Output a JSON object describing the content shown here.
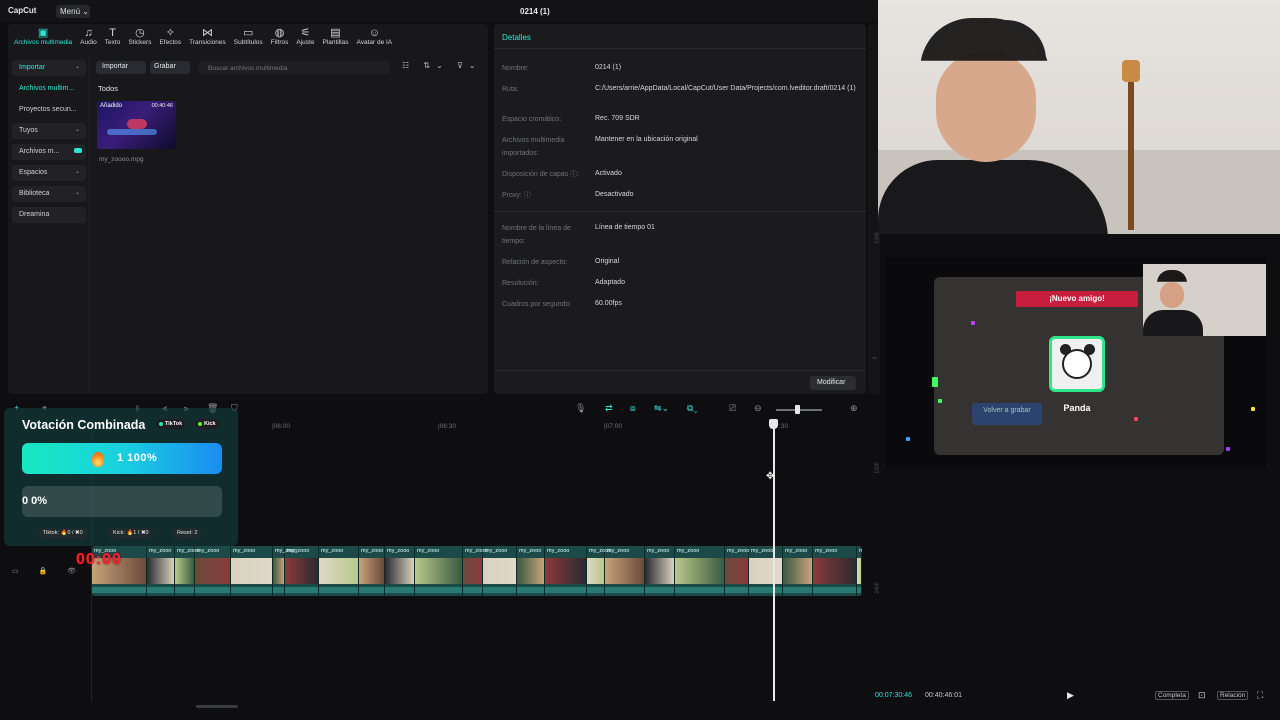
{
  "app": {
    "logo": "CapCut",
    "menu_label": "Menú ⌄",
    "project_title": "0214 (1)"
  },
  "toolbar": [
    {
      "label": "Archivos multimedia",
      "icon": "media-icon",
      "glyph": "▣",
      "active": true
    },
    {
      "label": "Audio",
      "icon": "audio-icon",
      "glyph": "♫"
    },
    {
      "label": "Texto",
      "icon": "text-icon",
      "glyph": "T"
    },
    {
      "label": "Stickers",
      "icon": "sticker-icon",
      "glyph": "◷"
    },
    {
      "label": "Efectos",
      "icon": "effects-icon",
      "glyph": "✧"
    },
    {
      "label": "Transiciones",
      "icon": "transitions-icon",
      "glyph": "⋈"
    },
    {
      "label": "Subtítulos",
      "icon": "subtitles-icon",
      "glyph": "▭"
    },
    {
      "label": "Filtros",
      "icon": "filters-icon",
      "glyph": "◍"
    },
    {
      "label": "Ajuste",
      "icon": "adjust-icon",
      "glyph": "⚟"
    },
    {
      "label": "Plantillas",
      "icon": "templates-icon",
      "glyph": "▤"
    },
    {
      "label": "Avatar de IA",
      "icon": "ai-avatar-icon",
      "glyph": "☺"
    }
  ],
  "sidenav": [
    {
      "label": "Importar",
      "style": "accent-box",
      "caret": "⌄"
    },
    {
      "label": "Archivos multim...",
      "style": "accent-plain"
    },
    {
      "label": "Proyectos secun...",
      "style": "plain"
    },
    {
      "label": "Tuyos",
      "style": "box",
      "caret": "⌄"
    },
    {
      "label": "Archivos m...",
      "style": "box",
      "toggle": true
    },
    {
      "label": "Espacios",
      "style": "box",
      "caret": "⌄"
    },
    {
      "label": "Biblioteca",
      "style": "box",
      "caret": "⌄"
    },
    {
      "label": "Dreamina",
      "style": "box"
    }
  ],
  "media": {
    "import_label": "Importar",
    "record_label": "Grabar",
    "search_placeholder": "Buscar archivos multimedia",
    "view_icons": "☷ ⇅⌄ ⊽⌄",
    "section_label": "Todos",
    "item": {
      "tag": "Añadido",
      "duration": "00:40:46",
      "name": "my_zoooo.mpg"
    }
  },
  "details": {
    "title": "Detalles",
    "rows": [
      {
        "key": "Nombre:",
        "value": "0214 (1)"
      },
      {
        "key": "Ruta:",
        "value": "C:/Users/arrie/AppData/Local/CapCut/User Data/Projects/com.lveditor.draft/0214 (1)"
      },
      {
        "key": "Espacio cromático:",
        "value": "Rec. 709 SDR"
      },
      {
        "key": "Archivos multimedia importados:",
        "value": "Mantener en la ubicación original"
      },
      {
        "key": "Disposición de capas ⓘ:",
        "value": "Activado"
      },
      {
        "key": "Proxy: ⓘ",
        "value": "Desactivado"
      },
      {
        "key": "Nombre de la línea de tiempo:",
        "value": "Línea de tiempo 01"
      },
      {
        "key": "Relación de aspecto:",
        "value": "Original"
      },
      {
        "key": "Resolución:",
        "value": "Adaptado"
      },
      {
        "key": "Cuadros por segundo:",
        "value": "60.00fps"
      }
    ],
    "modify_label": "Modificar"
  },
  "game": {
    "banner": "¡Nuevo amigo!",
    "card_name": "Panda",
    "button": "Volver a grabar"
  },
  "preview": {
    "current_time": "00:07:30:46",
    "total_time": "00:40:46:01",
    "play_glyph": "▶",
    "full_label": "Completa",
    "ratio_label": "Relación",
    "ruler_marks": [
      "1200",
      "0",
      "1200",
      "2400"
    ]
  },
  "timeline": {
    "ticks": [
      {
        "label": "|06:00"
      },
      {
        "label": "|06:30"
      },
      {
        "label": "|07:00"
      },
      {
        "label": "|07:30"
      }
    ],
    "clip_label": "my_zooo",
    "track_controls": "▭ 🔒 👁 🔈"
  },
  "vote": {
    "title": "Votación Combinada",
    "badge_tiktok": "TikTok",
    "badge_kick": "Kick",
    "bar1_text": "1  100%",
    "bar1_fill": 1.0,
    "bar2_text": "0   0%",
    "bar2_fill": 0.0,
    "foot_tiktok": "Tiktok: 🔥0 / ✖0",
    "foot_kick": "Kick: 🔥1 / ✖0",
    "foot_reset": "Reset: 2"
  },
  "overlay_timer": "00:00",
  "colors": {
    "accent": "#2ee6d6",
    "danger": "#ff1f2f",
    "tiktok": "#1de9b6",
    "kick": "#53fc18"
  }
}
